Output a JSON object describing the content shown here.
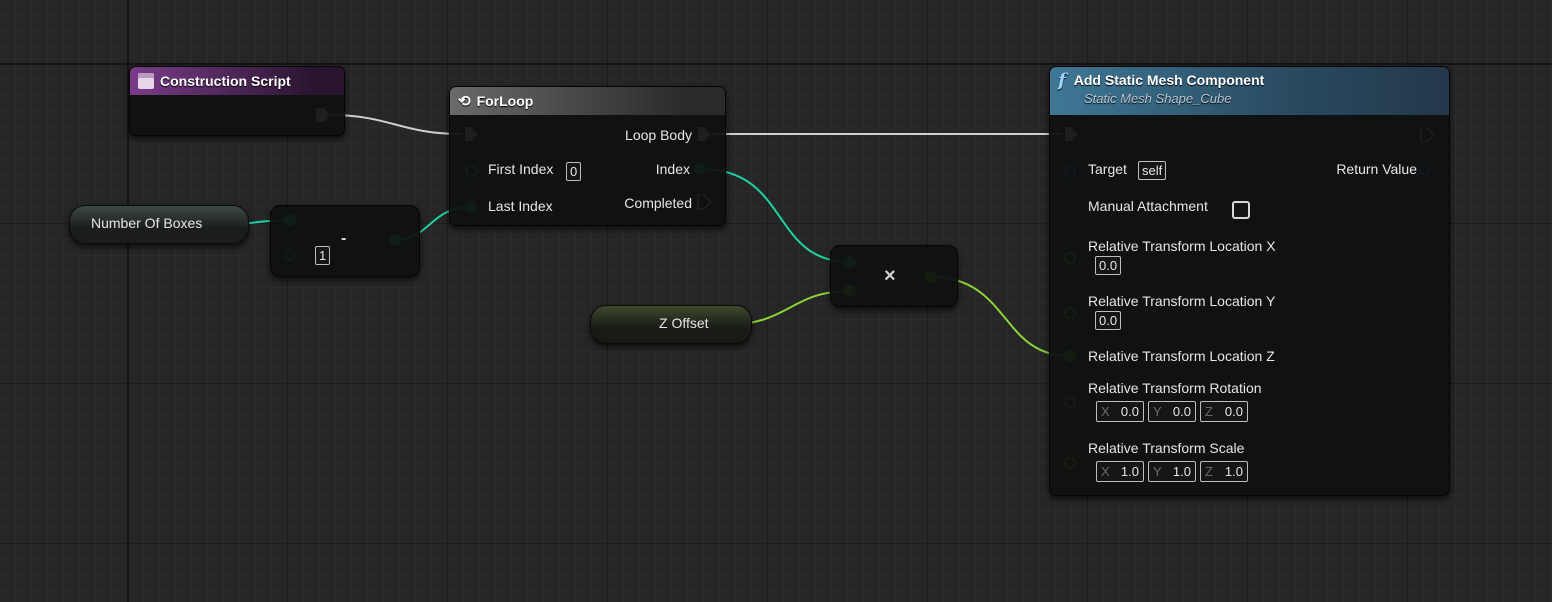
{
  "colors": {
    "exec": "#e8e8e8",
    "integer": "#1fd1a0",
    "float": "#8fd13a",
    "object": "#1ea7f0",
    "boolean": "#8a0e0e",
    "rotator": "#99a8ff",
    "vector": "#f0b41e"
  },
  "construction_script": {
    "title": "Construction Script",
    "icon": "construction-script-icon"
  },
  "number_of_boxes": {
    "label": "Number Of Boxes"
  },
  "subtract": {
    "default_value": "1",
    "operator": "-"
  },
  "forloop": {
    "title": "ForLoop",
    "icon": "loop-icon",
    "first_index_label": "First Index",
    "first_index_value": "0",
    "last_index_label": "Last Index",
    "loop_body_label": "Loop Body",
    "index_label": "Index",
    "completed_label": "Completed"
  },
  "z_offset": {
    "label": "Z Offset"
  },
  "multiply": {
    "operator": "×"
  },
  "add_component": {
    "title": "Add Static Mesh Component",
    "subtitle": "Static Mesh Shape_Cube",
    "icon": "function-icon",
    "icon_glyph": "f",
    "target_label": "Target",
    "target_value": "self",
    "return_label": "Return Value",
    "manual_attachment_label": "Manual Attachment",
    "loc_x_label": "Relative Transform Location X",
    "loc_x_value": "0.0",
    "loc_y_label": "Relative Transform Location Y",
    "loc_y_value": "0.0",
    "loc_z_label": "Relative Transform Location Z",
    "rotation_label": "Relative Transform Rotation",
    "rotation": {
      "x": "0.0",
      "y": "0.0",
      "z": "0.0"
    },
    "scale_label": "Relative Transform Scale",
    "scale": {
      "x": "1.0",
      "y": "1.0",
      "z": "1.0"
    },
    "axis_x": "X",
    "axis_y": "Y",
    "axis_z": "Z"
  }
}
